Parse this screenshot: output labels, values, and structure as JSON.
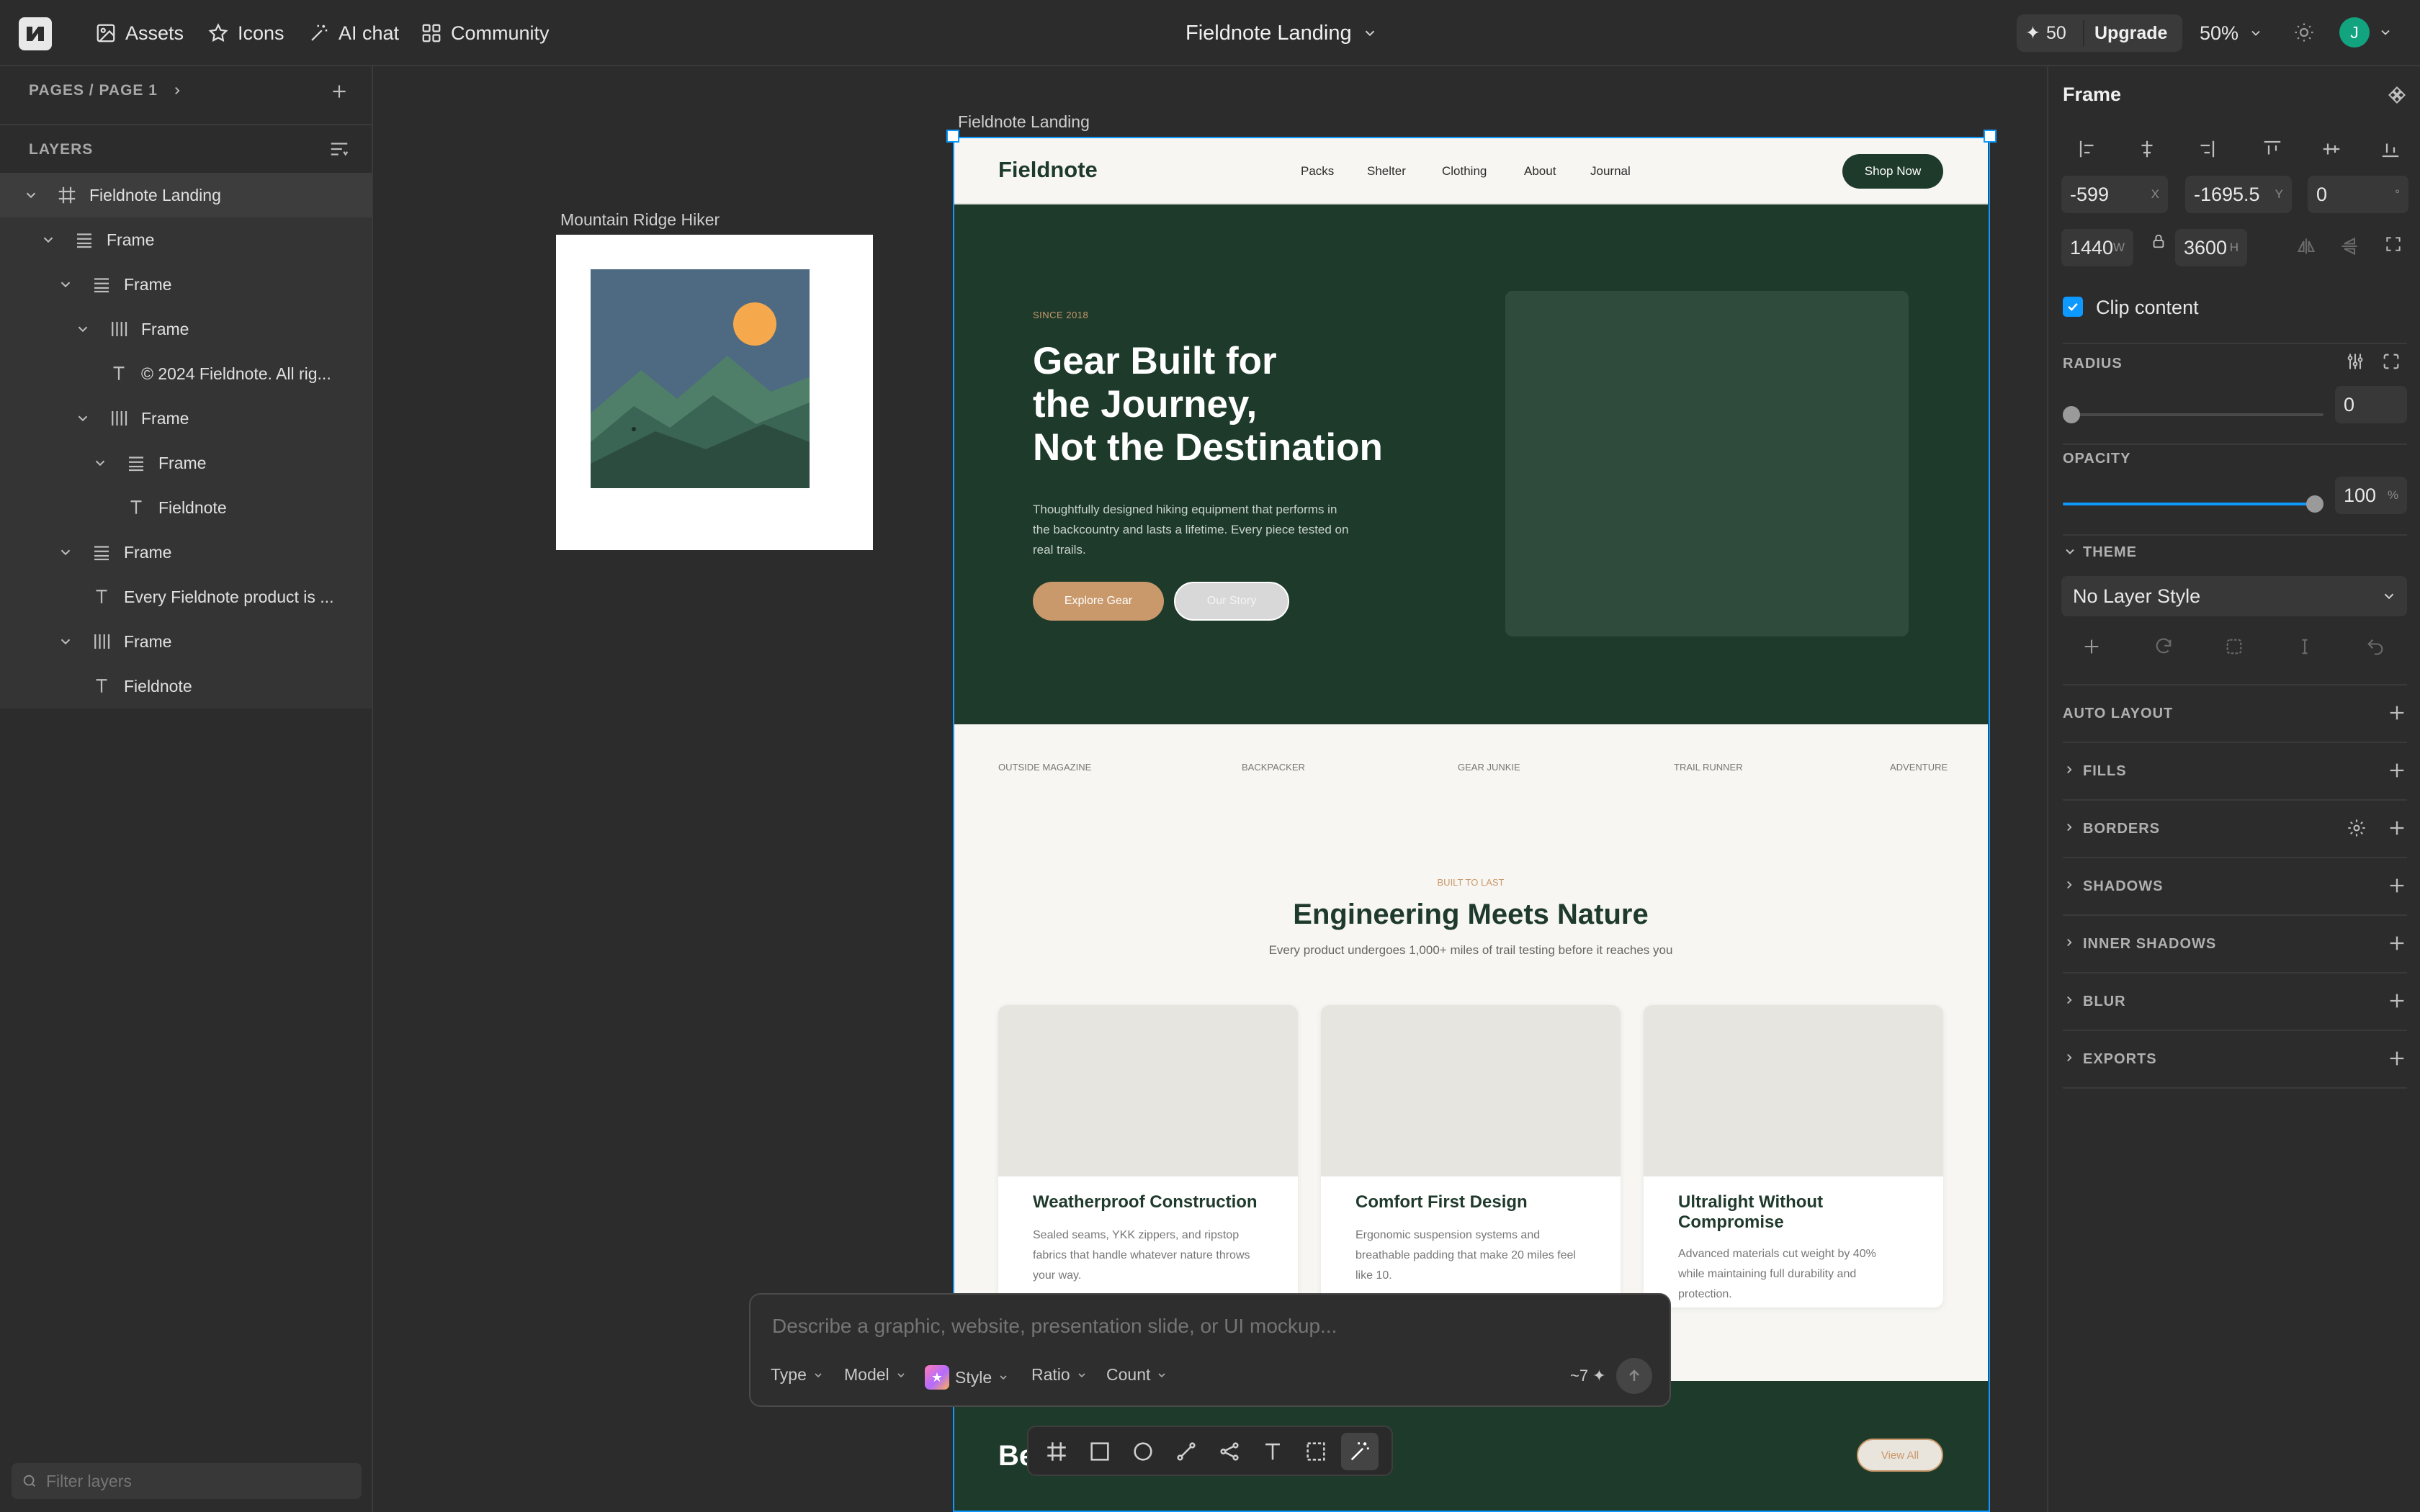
{
  "topbar": {
    "nav": [
      {
        "label": "Assets",
        "icon": "image-icon"
      },
      {
        "label": "Icons",
        "icon": "star-icon"
      },
      {
        "label": "AI chat",
        "icon": "magic-wand-icon"
      },
      {
        "label": "Community",
        "icon": "grid-icon"
      }
    ],
    "project_title": "Fieldnote Landing",
    "credits": "50",
    "upgrade_label": "Upgrade",
    "zoom": "50%",
    "avatar_initial": "J"
  },
  "left_panel": {
    "breadcrumb": "PAGES / PAGE 1",
    "layers_label": "LAYERS",
    "layers": [
      {
        "name": "Fieldnote Landing",
        "type": "frame-hash",
        "depth": 0,
        "expanded": true
      },
      {
        "name": "Frame",
        "type": "stack-rows",
        "depth": 1,
        "expanded": true
      },
      {
        "name": "Frame",
        "type": "stack-rows",
        "depth": 2,
        "expanded": true
      },
      {
        "name": "Frame",
        "type": "stack-cols",
        "depth": 3,
        "expanded": true
      },
      {
        "name": "© 2024 Fieldnote. All rig...",
        "type": "text",
        "depth": 4
      },
      {
        "name": "Frame",
        "type": "stack-cols",
        "depth": 3,
        "expanded": true
      },
      {
        "name": "Frame",
        "type": "stack-rows",
        "depth": 4,
        "expanded": true
      },
      {
        "name": "Fieldnote",
        "type": "text",
        "depth": 5
      },
      {
        "name": "Frame",
        "type": "stack-rows",
        "depth": 2,
        "expanded": true
      },
      {
        "name": "Every Fieldnote product is ...",
        "type": "text",
        "depth": 3
      },
      {
        "name": "Frame",
        "type": "stack-cols",
        "depth": 2,
        "expanded": true
      },
      {
        "name": "Fieldnote",
        "type": "text",
        "depth": 3
      }
    ],
    "filter_placeholder": "Filter layers"
  },
  "canvas": {
    "image_frame_title": "Mountain Ridge Hiker",
    "landing_frame_title": "Fieldnote Landing",
    "landing": {
      "brand": "Fieldnote",
      "nav": [
        "Packs",
        "Shelter",
        "Clothing",
        "About",
        "Journal"
      ],
      "shop_button": "Shop Now",
      "hero": {
        "eyebrow": "SINCE 2018",
        "headline": [
          "Gear Built for",
          "the Journey,",
          "Not the Destination"
        ],
        "body": [
          "Thoughtfully designed hiking equipment that performs in",
          "the backcountry and lasts a lifetime. Every piece tested on",
          "real trails."
        ],
        "primary_button": "Explore Gear",
        "secondary_button": "Our Story"
      },
      "press": [
        "OUTSIDE MAGAZINE",
        "BACKPACKER",
        "GEAR JUNKIE",
        "TRAIL RUNNER",
        "ADVENTURE"
      ],
      "features": {
        "eyebrow": "BUILT TO LAST",
        "title": "Engineering Meets Nature",
        "subtitle": "Every product undergoes 1,000+ miles of trail testing before it reaches you",
        "cards": [
          {
            "title": [
              "Weatherproof Construction"
            ],
            "body": [
              "Sealed seams, YKK zippers, and ripstop",
              "fabrics that handle whatever nature throws",
              "your way."
            ]
          },
          {
            "title": [
              "Comfort First Design"
            ],
            "body": [
              "Ergonomic suspension systems and",
              "breathable padding that make 20 miles feel",
              "like 10."
            ]
          },
          {
            "title": [
              "Ultralight Without",
              "Compromise"
            ],
            "body": [
              "Advanced materials cut weight by 40%",
              "while maintaining full durability and",
              "protection."
            ]
          }
        ]
      },
      "bottom_heading_partial": "Be",
      "view_all": "View All"
    }
  },
  "prompt": {
    "placeholder": "Describe a graphic, website, presentation slide, or UI mockup...",
    "options": [
      "Type",
      "Model",
      "Style",
      "Ratio",
      "Count"
    ],
    "cost": "~7"
  },
  "right_panel": {
    "title": "Frame",
    "x": "-599",
    "y": "-1695.5",
    "rotation": "0",
    "w": "1440",
    "h": "3600",
    "x_label": "X",
    "y_label": "Y",
    "w_label": "W",
    "h_label": "H",
    "clip_label": "Clip content",
    "clip_checked": true,
    "radius_label": "RADIUS",
    "radius_value": "0",
    "opacity_label": "OPACITY",
    "opacity_value": "100",
    "opacity_unit": "%",
    "theme_label": "THEME",
    "theme_value": "No Layer Style",
    "sections": [
      "AUTO LAYOUT",
      "FILLS",
      "BORDERS",
      "SHADOWS",
      "INNER SHADOWS",
      "BLUR",
      "EXPORTS"
    ]
  },
  "colors": {
    "accent": "#0d99ff",
    "forest": "#1e3a2b",
    "tan": "#c9996b",
    "avatar": "#12a37f"
  }
}
